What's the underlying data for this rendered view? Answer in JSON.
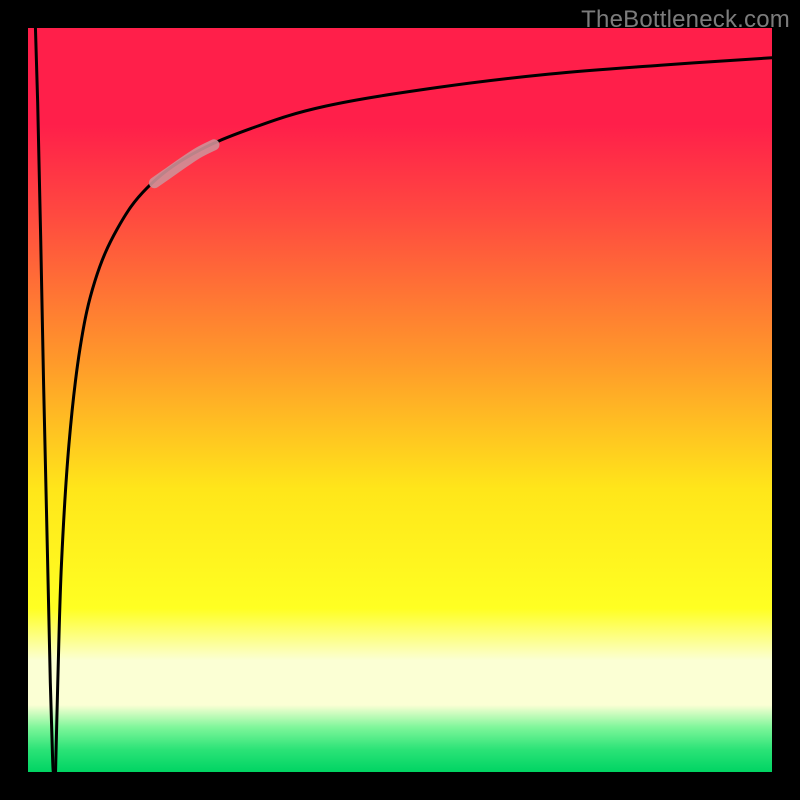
{
  "watermark": "TheBottleneck.com",
  "colors": {
    "top": "#ff1f4a",
    "red2": "#ff4940",
    "orange": "#ff9a2a",
    "yellow": "#ffe61a",
    "yellow2": "#ffff22",
    "pale": "#fbffd4",
    "green1": "#7ef69a",
    "green2": "#2be377",
    "green3": "#00d463"
  },
  "chart_data": {
    "type": "line",
    "title": "",
    "xlabel": "",
    "ylabel": "",
    "xlim": [
      0,
      100
    ],
    "ylim": [
      0,
      100
    ],
    "notes": "Two curve branches plotted over a red→green vertical gradient; both descend sharply near x≈3 to y≈0 (minimum bottleneck) then the right branch rises logarithmically toward ~96. A faint pink overlay segment sits on the right branch between roughly x 17–25.",
    "series": [
      {
        "name": "left-branch",
        "x": [
          1.0,
          1.3,
          1.7,
          2.1,
          2.6,
          3.0,
          3.3,
          3.4
        ],
        "values": [
          100,
          90,
          72,
          52,
          30,
          12,
          2,
          0
        ]
      },
      {
        "name": "right-branch",
        "x": [
          3.7,
          4.0,
          4.5,
          5.5,
          7,
          9,
          12,
          16,
          22,
          30,
          40,
          55,
          70,
          85,
          100
        ],
        "values": [
          0,
          12,
          28,
          44,
          57,
          66,
          73,
          78.5,
          83,
          86.5,
          89.5,
          92,
          93.8,
          95,
          96
        ]
      },
      {
        "name": "highlight-segment",
        "x": [
          17,
          19,
          21,
          23,
          25
        ],
        "values": [
          79.2,
          80.6,
          82.0,
          83.3,
          84.3
        ]
      }
    ]
  }
}
